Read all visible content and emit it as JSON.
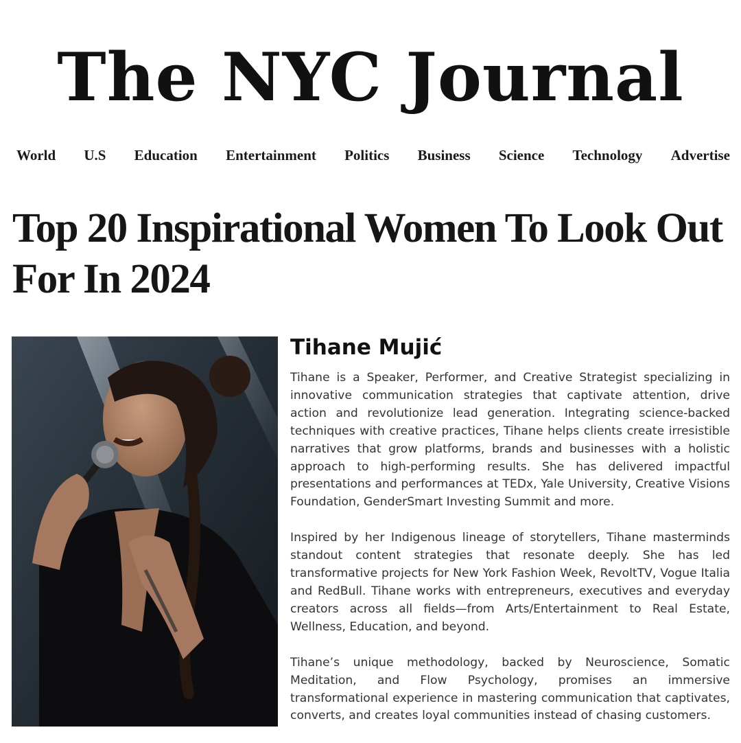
{
  "masthead": {
    "title": "The NYC Journal"
  },
  "nav": {
    "items": [
      "World",
      "U.S",
      "Education",
      "Entertainment",
      "Politics",
      "Business",
      "Science",
      "Technology",
      "Advertise"
    ]
  },
  "article": {
    "headline": "Top 20 Inspirational Women To Look Out For In 2024",
    "name": "Tihane Mujić",
    "paragraphs": [
      "Tihane is a Speaker, Performer, and Creative Strategist specializing in innovative communication strategies that captivate attention, drive action and revolutionize lead generation. Integrating science-backed techniques with creative practices, Tihane helps clients create irresistible narratives that grow platforms, brands and businesses with a holistic approach to high-performing results. She has delivered impactful presentations and performances at TEDx, Yale University, Creative Visions Foundation, GenderSmart Investing Summit and more.",
      "Inspired by her Indigenous lineage of storytellers, Tihane masterminds standout content strategies that resonate deeply. She has led transformative projects for New York Fashion Week, RevoltTV, Vogue Italia and RedBull. Tihane works with entrepreneurs, executives and everyday creators across all fields—from Arts/Entertainment to Real Estate, Wellness, Education, and beyond.",
      "Tihane’s unique methodology, backed by Neuroscience, Somatic Meditation, and Flow Psychology, promises an immersive transformational experience in mastering communication that captivates, converts, and creates loyal communities instead of chasing customers."
    ]
  },
  "photo": {
    "icon": "portrait-photo"
  },
  "colors": {
    "text": "#1a1a1a",
    "body_text": "#333333",
    "background": "#ffffff"
  }
}
